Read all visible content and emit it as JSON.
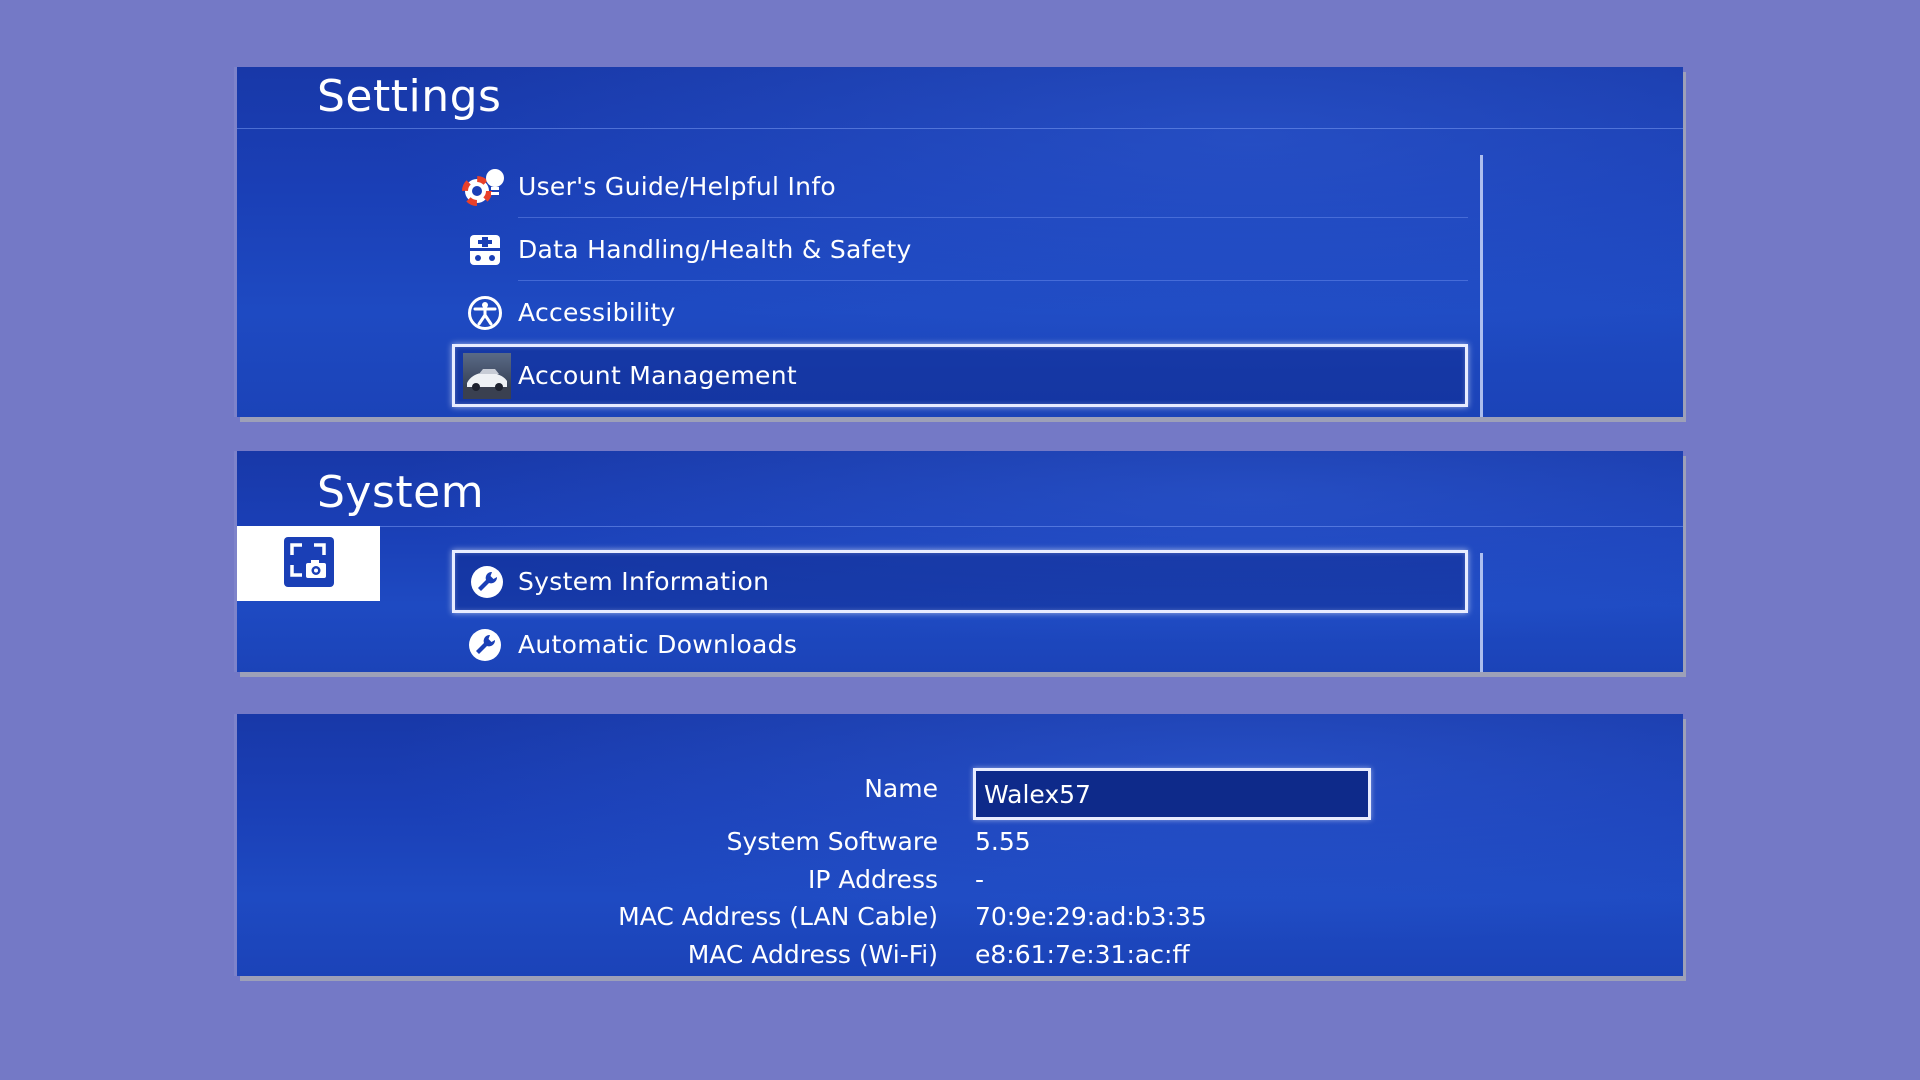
{
  "settings": {
    "title": "Settings",
    "items": [
      {
        "label": "User's Guide/Helpful Info",
        "icon": "lifebuoy-lightbulb-icon"
      },
      {
        "label": "Data Handling/Health & Safety",
        "icon": "data-safety-icon"
      },
      {
        "label": "Accessibility",
        "icon": "accessibility-icon"
      },
      {
        "label": "Account Management",
        "icon": "account-avatar-car-icon",
        "selected": true
      }
    ]
  },
  "system": {
    "title": "System",
    "capture_icon": "screenshot-camera-icon",
    "items": [
      {
        "label": "System Information",
        "icon": "wrench-icon",
        "selected": true
      },
      {
        "label": "Automatic Downloads",
        "icon": "wrench-icon"
      }
    ]
  },
  "system_information": {
    "name_label": "Name",
    "name_value": "Walex57",
    "rows": [
      {
        "label": "System Software",
        "value": "5.55"
      },
      {
        "label": "IP Address",
        "value": "-"
      },
      {
        "label": "MAC Address (LAN Cable)",
        "value": "70:9e:29:ad:b3:35"
      },
      {
        "label": "MAC Address (Wi-Fi)",
        "value": "e8:61:7e:31:ac:ff"
      }
    ]
  },
  "colors": {
    "background": "#7479c6",
    "panel": "#1a3fb6",
    "highlight_border": "#e8ecff",
    "capture_tab": "#ffffff"
  }
}
